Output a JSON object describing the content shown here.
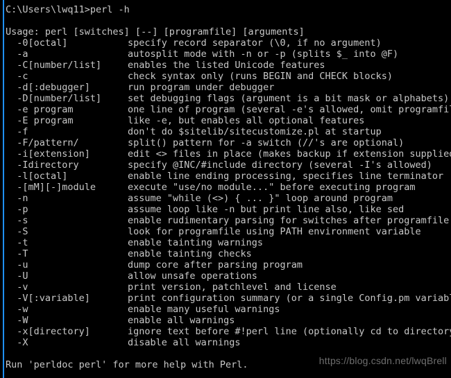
{
  "window": {
    "type": "windows-command-prompt",
    "background_color": "#000000",
    "text_color": "#c8c8c8",
    "accent_stripe_color": "#1e90ff"
  },
  "prompt_line": "C:\\Users\\lwq11>perl -h",
  "usage_line": "Usage: perl [switches] [--] [programfile] [arguments]",
  "switches": [
    {
      "switch": "  -0[octal]",
      "description": "specify record separator (\\0, if no argument)"
    },
    {
      "switch": "  -a",
      "description": "autosplit mode with -n or -p (splits $_ into @F)"
    },
    {
      "switch": "  -C[number/list]",
      "description": "enables the listed Unicode features"
    },
    {
      "switch": "  -c",
      "description": "check syntax only (runs BEGIN and CHECK blocks)"
    },
    {
      "switch": "  -d[:debugger]",
      "description": "run program under debugger"
    },
    {
      "switch": "  -D[number/list]",
      "description": "set debugging flags (argument is a bit mask or alphabets)"
    },
    {
      "switch": "  -e program",
      "description": "one line of program (several -e's allowed, omit programfile)"
    },
    {
      "switch": "  -E program",
      "description": "like -e, but enables all optional features"
    },
    {
      "switch": "  -f",
      "description": "don't do $sitelib/sitecustomize.pl at startup"
    },
    {
      "switch": "  -F/pattern/",
      "description": "split() pattern for -a switch (//'s are optional)"
    },
    {
      "switch": "  -i[extension]",
      "description": "edit <> files in place (makes backup if extension supplied)"
    },
    {
      "switch": "  -Idirectory",
      "description": "specify @INC/#include directory (several -I's allowed)"
    },
    {
      "switch": "  -l[octal]",
      "description": "enable line ending processing, specifies line terminator"
    },
    {
      "switch": "  -[mM][-]module",
      "description": "execute \"use/no module...\" before executing program"
    },
    {
      "switch": "  -n",
      "description": "assume \"while (<>) { ... }\" loop around program"
    },
    {
      "switch": "  -p",
      "description": "assume loop like -n but print line also, like sed"
    },
    {
      "switch": "  -s",
      "description": "enable rudimentary parsing for switches after programfile"
    },
    {
      "switch": "  -S",
      "description": "look for programfile using PATH environment variable"
    },
    {
      "switch": "  -t",
      "description": "enable tainting warnings"
    },
    {
      "switch": "  -T",
      "description": "enable tainting checks"
    },
    {
      "switch": "  -u",
      "description": "dump core after parsing program"
    },
    {
      "switch": "  -U",
      "description": "allow unsafe operations"
    },
    {
      "switch": "  -v",
      "description": "print version, patchlevel and license"
    },
    {
      "switch": "  -V[:variable]",
      "description": "print configuration summary (or a single Config.pm variable)"
    },
    {
      "switch": "  -w",
      "description": "enable many useful warnings"
    },
    {
      "switch": "  -W",
      "description": "enable all warnings"
    },
    {
      "switch": "  -x[directory]",
      "description": "ignore text before #!perl line (optionally cd to directory)"
    },
    {
      "switch": "  -X",
      "description": "disable all warnings"
    }
  ],
  "footer_line": "Run 'perldoc perl' for more help with Perl.",
  "watermark": "https://blog.csdn.net/lwqBrell"
}
